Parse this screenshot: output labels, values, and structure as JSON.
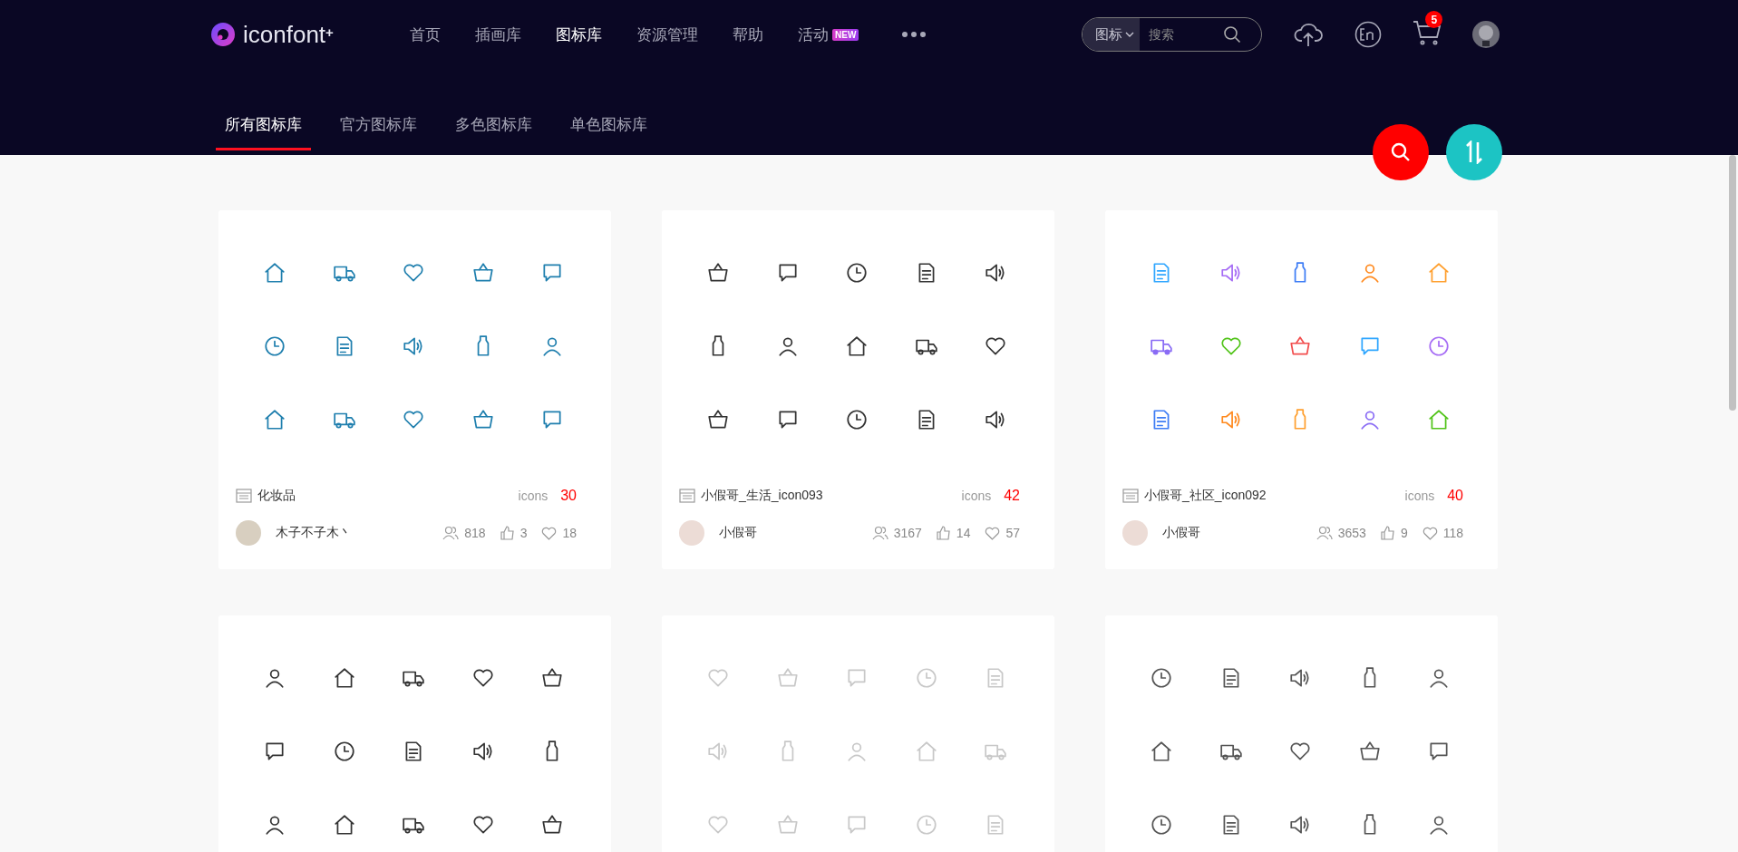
{
  "header": {
    "logo": "iconfont",
    "logo_mark": "+",
    "nav": [
      {
        "label": "首页",
        "selected": false
      },
      {
        "label": "插画库",
        "selected": false
      },
      {
        "label": "图标库",
        "selected": true
      },
      {
        "label": "资源管理",
        "selected": false
      },
      {
        "label": "帮助",
        "selected": false
      },
      {
        "label": "活动",
        "selected": false,
        "badge": "NEW"
      }
    ],
    "search": {
      "scope": "图标",
      "placeholder": "搜索"
    },
    "cart_count": "5"
  },
  "tabs": [
    {
      "label": "所有图标库",
      "selected": true
    },
    {
      "label": "官方图标库",
      "selected": false
    },
    {
      "label": "多色图标库",
      "selected": false
    },
    {
      "label": "单色图标库",
      "selected": false
    }
  ],
  "libraries": [
    {
      "kind": "line",
      "color": "#1f7fae",
      "name": "化妆品",
      "unit": "icons",
      "count": "30",
      "author": "木子不子木丶",
      "users": "818",
      "likes": "3",
      "favorites": "18"
    },
    {
      "kind": "line",
      "color": "#333333",
      "name": "小假哥_生活_icon093",
      "unit": "icons",
      "count": "42",
      "author": "小假哥",
      "users": "3167",
      "likes": "14",
      "favorites": "57"
    },
    {
      "kind": "multicolor",
      "name": "小假哥_社区_icon092",
      "unit": "icons",
      "count": "40",
      "author": "小假哥",
      "users": "3653",
      "likes": "9",
      "favorites": "118"
    },
    {
      "kind": "line",
      "color": "#333333"
    },
    {
      "kind": "line",
      "color": "#c8c8c8"
    },
    {
      "kind": "line",
      "color": "#555555"
    }
  ]
}
